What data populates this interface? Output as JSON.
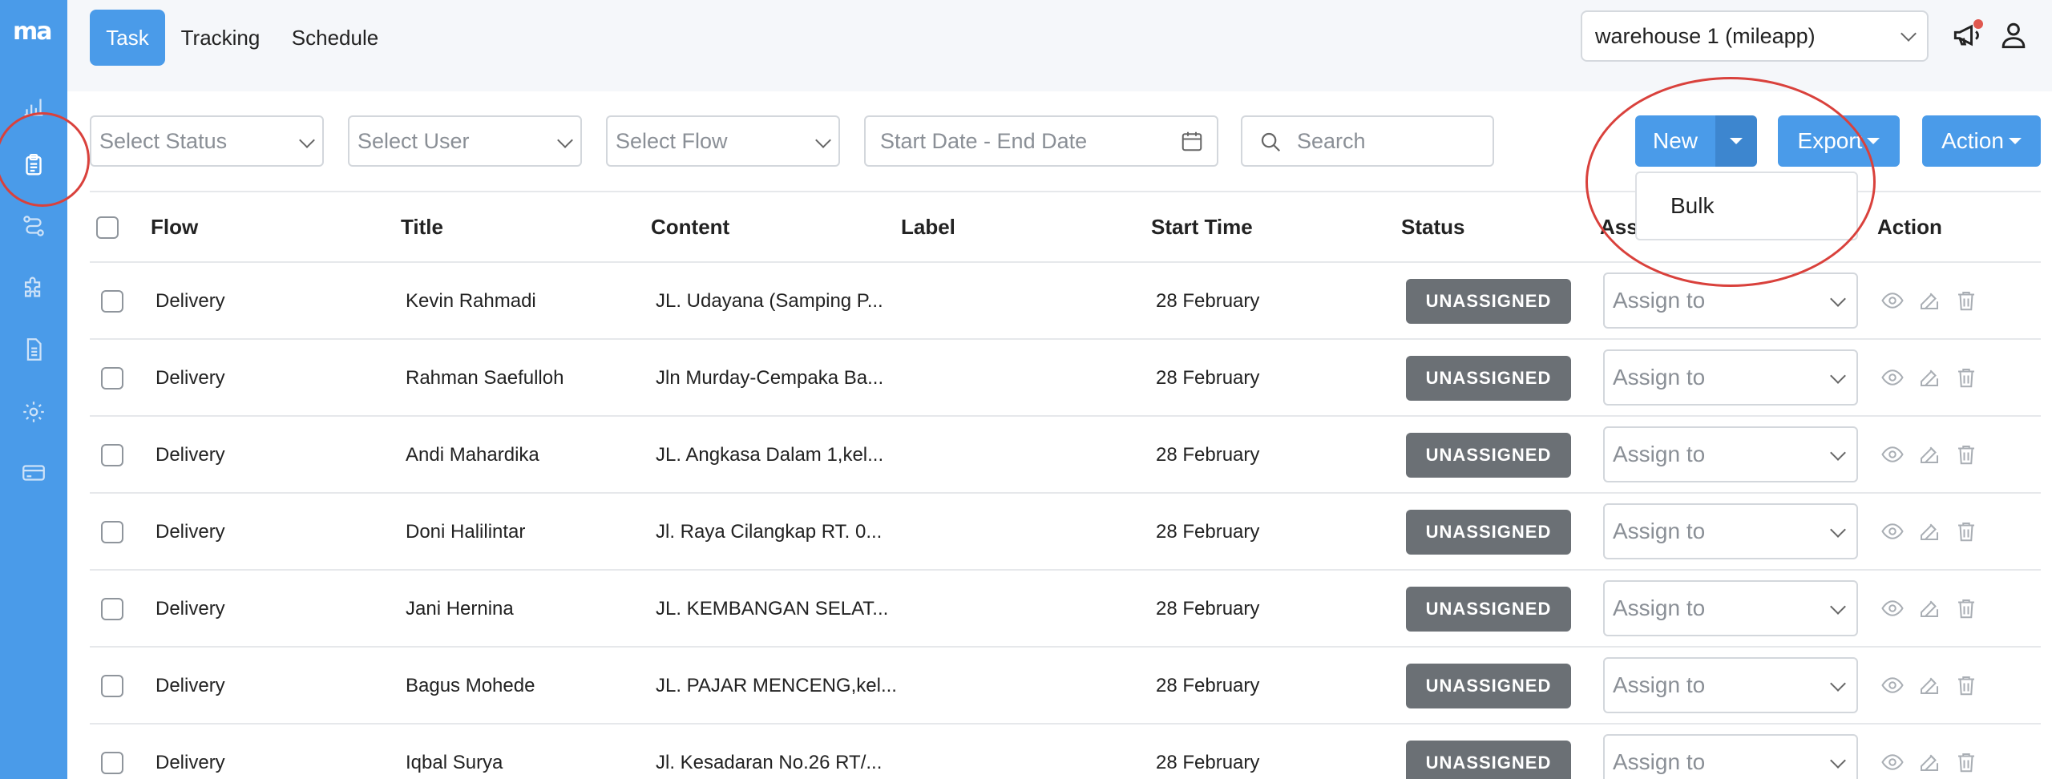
{
  "app": {
    "logo_text": "ma"
  },
  "sidebar": {
    "items": [
      {
        "icon": "bar-chart-icon"
      },
      {
        "icon": "clipboard-icon",
        "active": true
      },
      {
        "icon": "route-icon"
      },
      {
        "icon": "puzzle-icon"
      },
      {
        "icon": "document-icon"
      },
      {
        "icon": "gear-icon"
      },
      {
        "icon": "credit-card-icon"
      }
    ]
  },
  "header": {
    "tabs": [
      {
        "label": "Task",
        "active": true
      },
      {
        "label": "Tracking"
      },
      {
        "label": "Schedule"
      }
    ],
    "warehouse_select": {
      "value": "warehouse 1 (mileapp)"
    }
  },
  "filters": {
    "status_placeholder": "Select Status",
    "user_placeholder": "Select User",
    "flow_placeholder": "Select Flow",
    "date_placeholder": "Start Date - End Date",
    "search_placeholder": "Search"
  },
  "buttons": {
    "new_label": "New",
    "export_label": "Export",
    "action_label": "Action",
    "new_menu": [
      "Bulk"
    ]
  },
  "table": {
    "columns": {
      "flow": "Flow",
      "title": "Title",
      "content": "Content",
      "label": "Label",
      "start_time": "Start Time",
      "status": "Status",
      "assign": "Ass",
      "action": "Action"
    },
    "assign_placeholder": "Assign to",
    "rows": [
      {
        "flow": "Delivery",
        "title": "Kevin Rahmadi",
        "content": "JL. Udayana (Samping P...",
        "label": "",
        "start_time": "28 February",
        "status": "UNASSIGNED"
      },
      {
        "flow": "Delivery",
        "title": "Rahman Saefulloh",
        "content": "Jln Murday-Cempaka Ba...",
        "label": "",
        "start_time": "28 February",
        "status": "UNASSIGNED"
      },
      {
        "flow": "Delivery",
        "title": "Andi Mahardika",
        "content": "JL. Angkasa Dalam 1,kel...",
        "label": "",
        "start_time": "28 February",
        "status": "UNASSIGNED"
      },
      {
        "flow": "Delivery",
        "title": "Doni Halilintar",
        "content": "Jl. Raya Cilangkap RT. 0...",
        "label": "",
        "start_time": "28 February",
        "status": "UNASSIGNED"
      },
      {
        "flow": "Delivery",
        "title": "Jani Hernina",
        "content": "JL. KEMBANGAN SELAT...",
        "label": "",
        "start_time": "28 February",
        "status": "UNASSIGNED"
      },
      {
        "flow": "Delivery",
        "title": "Bagus Mohede",
        "content": "JL. PAJAR MENCENG,kel...",
        "label": "",
        "start_time": "28 February",
        "status": "UNASSIGNED"
      },
      {
        "flow": "Delivery",
        "title": "Iqbal Surya",
        "content": "Jl. Kesadaran No.26 RT/...",
        "label": "",
        "start_time": "28 February",
        "status": "UNASSIGNED"
      }
    ]
  },
  "colors": {
    "primary": "#4a9be9",
    "sidebar": "#4a9be9",
    "badge_unassigned": "#6b7075",
    "highlight_ring": "#d9413c",
    "notification_dot": "#e0584f"
  }
}
